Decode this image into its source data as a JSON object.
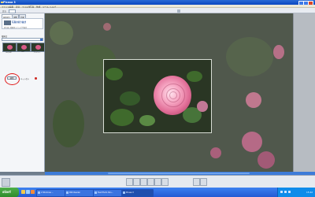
{
  "window": {
    "title": "Picasa 3",
    "menu": [
      "ファイル",
      "編集",
      "表示",
      "フォルダ",
      "写真",
      "作成",
      "ツール",
      "ヘルプ"
    ]
  },
  "toolbar": {
    "zoom_label": "戻る",
    "zoom_value": ""
  },
  "left_panel": {
    "tabs": [
      "基本修正",
      "調整",
      "効果"
    ],
    "info_heading": "写真の切り抜き",
    "info_desc": "切り抜く範囲をドラッグで指定",
    "section_label": "縦横比",
    "select_value": "",
    "presets": [
      {
        "caption": "元の比率",
        "selected": false
      },
      {
        "caption": "4x6",
        "selected": false
      },
      {
        "caption": "プレビュー",
        "selected": false
      }
    ],
    "apply_label": "適用",
    "link_text": "キャンセル"
  },
  "status": {
    "center_text": "",
    "icons": [
      "share-icon",
      "email-icon",
      "print-icon",
      "export-icon",
      "order-icon",
      "blog-icon",
      "movie-icon",
      "collage-icon"
    ]
  },
  "taskbar": {
    "start_label": "start",
    "tasks": [
      "2 Windows ...",
      "RSS Reader",
      "Fast Photo Sho...",
      "Picasa 3"
    ],
    "clock": "15:42"
  },
  "colors": {
    "accent": "#2b6bd6",
    "highlight": "#e01818"
  }
}
